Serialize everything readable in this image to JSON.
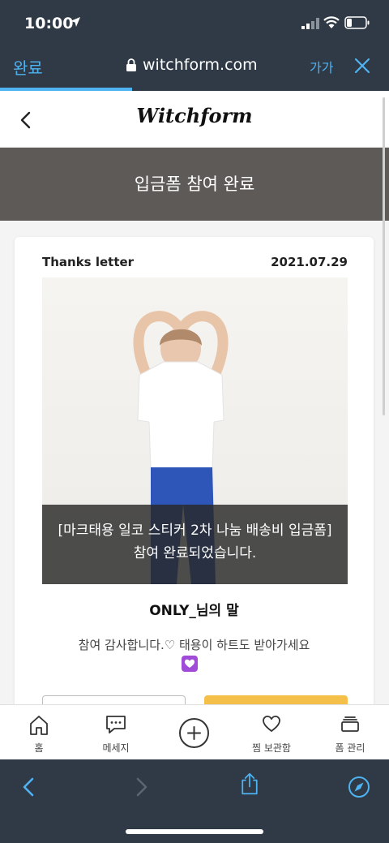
{
  "status_bar": {
    "time": "10:00"
  },
  "browser": {
    "done_label": "완료",
    "url": "witchform.com",
    "text_size_label": "가가",
    "load_progress": 0.34
  },
  "site": {
    "logo": "Witchform"
  },
  "banner": {
    "text": "입금폼 참여 완료"
  },
  "card": {
    "title": "Thanks letter",
    "date": "2021.07.29",
    "caption_line1": "[마크태용 일코 스티커 2차 나눔 배송비 입금폼]",
    "caption_line2": "참여 완료되었습니다.",
    "owner": "ONLY_님의 말",
    "message": "참여 감사합니다.♡ 태용이 하트도 받아가세요"
  },
  "tab_bar": {
    "items": [
      {
        "label": "홈",
        "icon": "home-icon"
      },
      {
        "label": "메세지",
        "icon": "message-icon"
      },
      {
        "label": "",
        "icon": "plus-circle-icon"
      },
      {
        "label": "찜 보관함",
        "icon": "heart-icon"
      },
      {
        "label": "폼 관리",
        "icon": "layers-icon"
      }
    ]
  },
  "colors": {
    "chrome_bg": "#2f3a46",
    "accent_blue": "#4fb3f2",
    "banner_bg": "#5e5a57",
    "yellow_button": "#f5c04a",
    "heart_emoji": "#a04cd8"
  }
}
